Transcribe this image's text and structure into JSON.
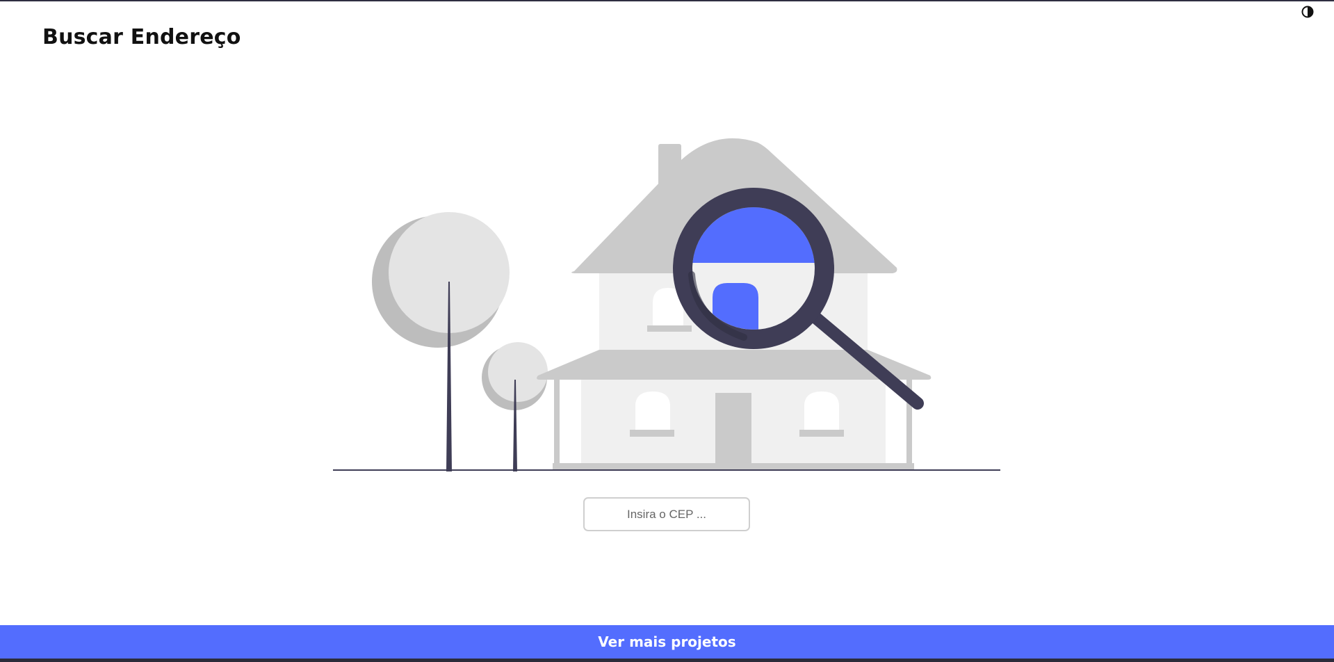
{
  "header": {
    "title": "Buscar Endereço",
    "theme_toggle_icon": "contrast-icon"
  },
  "search": {
    "placeholder": "Insira o CEP ...",
    "value": ""
  },
  "footer": {
    "link_label": "Ver mais projetos"
  },
  "colors": {
    "accent": "#536dfe",
    "dark": "#2f2e41",
    "house_gray": "#cacaca",
    "wall_light": "#f0f0f0"
  },
  "illustration": {
    "icon": "house-search-illustration"
  }
}
